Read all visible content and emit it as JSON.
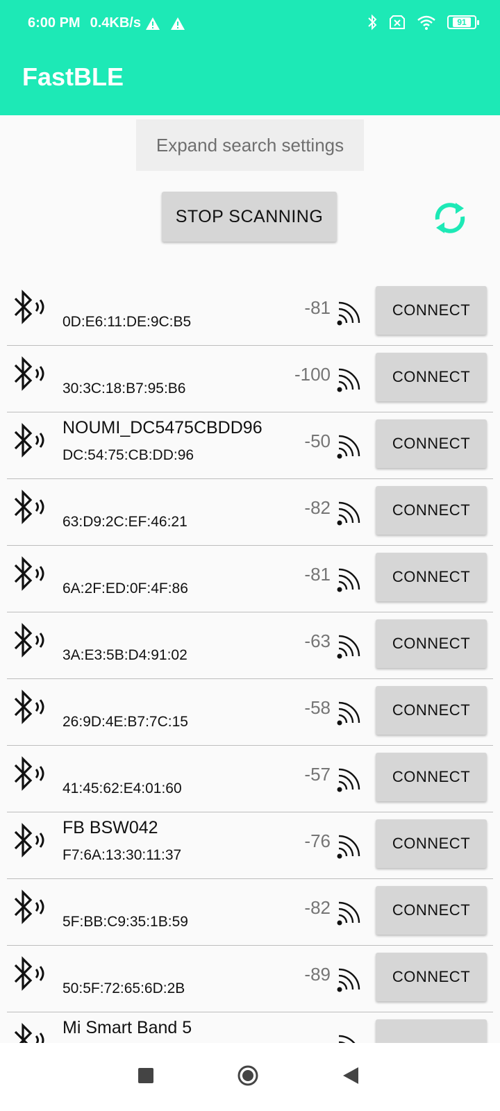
{
  "status_bar": {
    "time": "6:00 PM",
    "speed": "0.4KB/s",
    "battery": "91"
  },
  "app": {
    "title": "FastBLE"
  },
  "controls": {
    "expand_label": "Expand search settings",
    "stop_label": "STOP SCANNING"
  },
  "devices": [
    {
      "name": "",
      "mac": "0D:E6:11:DE:9C:B5",
      "rssi": "-81",
      "button": "CONNECT"
    },
    {
      "name": "",
      "mac": "30:3C:18:B7:95:B6",
      "rssi": "-100",
      "button": "CONNECT"
    },
    {
      "name": "NOUMI_DC5475CBDD96",
      "mac": "DC:54:75:CB:DD:96",
      "rssi": "-50",
      "button": "CONNECT"
    },
    {
      "name": "",
      "mac": "63:D9:2C:EF:46:21",
      "rssi": "-82",
      "button": "CONNECT"
    },
    {
      "name": "",
      "mac": "6A:2F:ED:0F:4F:86",
      "rssi": "-81",
      "button": "CONNECT"
    },
    {
      "name": "",
      "mac": "3A:E3:5B:D4:91:02",
      "rssi": "-63",
      "button": "CONNECT"
    },
    {
      "name": "",
      "mac": "26:9D:4E:B7:7C:15",
      "rssi": "-58",
      "button": "CONNECT"
    },
    {
      "name": "",
      "mac": "41:45:62:E4:01:60",
      "rssi": "-57",
      "button": "CONNECT"
    },
    {
      "name": "FB BSW042",
      "mac": "F7:6A:13:30:11:37",
      "rssi": "-76",
      "button": "CONNECT"
    },
    {
      "name": "",
      "mac": "5F:BB:C9:35:1B:59",
      "rssi": "-82",
      "button": "CONNECT"
    },
    {
      "name": "",
      "mac": "50:5F:72:65:6D:2B",
      "rssi": "-89",
      "button": "CONNECT"
    },
    {
      "name": "Mi Smart Band 5",
      "mac": "",
      "rssi": "",
      "button": ""
    }
  ],
  "icons": {
    "bluetooth": "bluetooth-icon",
    "signal": "signal-strength-icon",
    "refresh": "refresh-icon",
    "nav_recents": "square-icon",
    "nav_home": "circle-icon",
    "nav_back": "back-triangle-icon"
  },
  "colors": {
    "accent": "#1de9b6",
    "button_bg": "#d6d6d6"
  }
}
